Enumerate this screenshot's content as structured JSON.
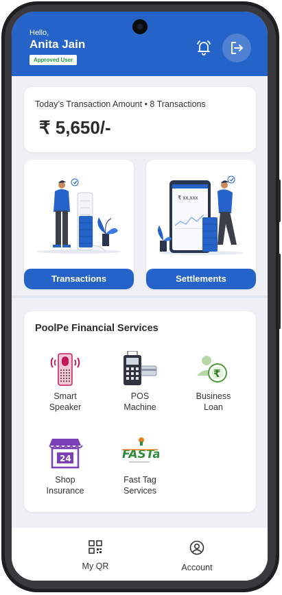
{
  "header": {
    "greeting": "Hello,",
    "user_name": "Anita Jain",
    "status_badge": "Approved User"
  },
  "summary": {
    "label": "Today’s Transaction Amount • 8 Transactions",
    "amount": "₹ 5,650/-"
  },
  "tiles": [
    {
      "label": "Transactions"
    },
    {
      "label": "Settlements",
      "screen_text": "₹ xx,xxx"
    }
  ],
  "services": {
    "title": "PoolPe Financial Services",
    "items": [
      {
        "line1": "Smart",
        "line2": "Speaker",
        "icon": "smart-speaker-icon"
      },
      {
        "line1": "POS",
        "line2": "Machine",
        "icon": "pos-machine-icon"
      },
      {
        "line1": "Business",
        "line2": "Loan",
        "icon": "business-loan-icon"
      },
      {
        "line1": "Shop",
        "line2": "Insurance",
        "icon": "shop-insurance-icon",
        "badge": "24"
      },
      {
        "line1": "Fast Tag",
        "line2": "Services",
        "icon": "fastag-icon",
        "logo_text": "FASTag"
      }
    ]
  },
  "bottom_nav": [
    {
      "label": "My QR",
      "icon": "qr-code-icon"
    },
    {
      "label": "Account",
      "icon": "account-icon"
    }
  ],
  "colors": {
    "primary": "#2563c9",
    "approved_green": "#1c9b3e",
    "background": "#eef0f5"
  }
}
